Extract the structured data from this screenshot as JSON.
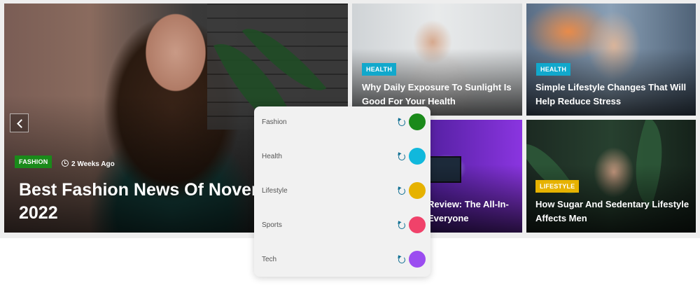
{
  "slider": {
    "featured": {
      "category": "FASHION",
      "category_color": "#1a8a1a",
      "time": "2 Weeks Ago",
      "title": "Best Fashion News Of Novemb",
      "title_line2": "2022"
    },
    "cards": [
      {
        "category": "HEALTH",
        "category_color": "#11a8cc",
        "title_l1": "Why Daily Exposure To Sunlight Is",
        "title_l2": "Good For Your Health"
      },
      {
        "category": "HEALTH",
        "category_color": "#11a8cc",
        "title_l1": "Simple Lifestyle Changes That Will",
        "title_l2": "Help Reduce Stress"
      },
      {
        "title_l1": "Review: The All-In-",
        "title_l2": "Everyone"
      },
      {
        "category": "LIFESTYLE",
        "category_color": "#e6b200",
        "title_l1": "How Sugar And Sedentary Lifestyle",
        "title_l2": "Affects Men"
      }
    ]
  },
  "color_picker": {
    "items": [
      {
        "label": "Fashion",
        "color": "#1a8a1a"
      },
      {
        "label": "Health",
        "color": "#11b8dc"
      },
      {
        "label": "Lifestyle",
        "color": "#e6b200"
      },
      {
        "label": "Sports",
        "color": "#f0426a"
      },
      {
        "label": "Tech",
        "color": "#9b4df0"
      }
    ]
  }
}
